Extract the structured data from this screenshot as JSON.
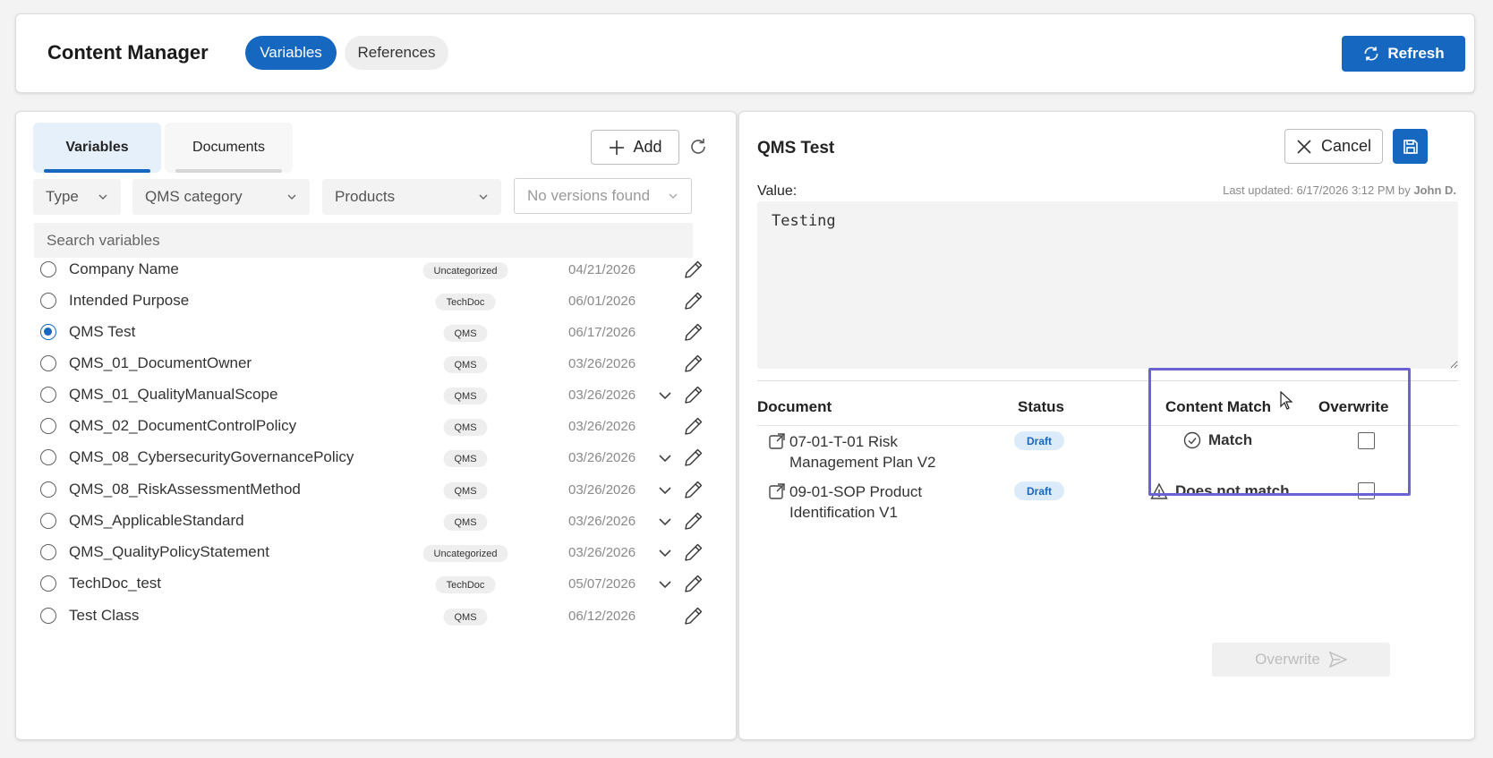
{
  "header": {
    "title": "Content Manager",
    "tabs": [
      {
        "label": "Variables",
        "active": true
      },
      {
        "label": "References",
        "active": false
      }
    ],
    "refresh_label": "Refresh"
  },
  "left": {
    "subtabs": [
      {
        "label": "Variables",
        "active": true
      },
      {
        "label": "Documents",
        "active": false
      }
    ],
    "add_label": "Add",
    "filters": {
      "type": "Type",
      "qms_category": "QMS category",
      "products": "Products",
      "versions": "No versions found"
    },
    "search_placeholder": "Search variables",
    "variables": [
      {
        "name": "Company Name",
        "category": "Uncategorized",
        "date": "04/21/2026",
        "expandable": false,
        "selected": false
      },
      {
        "name": "Intended Purpose",
        "category": "TechDoc",
        "date": "06/01/2026",
        "expandable": false,
        "selected": false
      },
      {
        "name": "QMS Test",
        "category": "QMS",
        "date": "06/17/2026",
        "expandable": false,
        "selected": true
      },
      {
        "name": "QMS_01_DocumentOwner",
        "category": "QMS",
        "date": "03/26/2026",
        "expandable": false,
        "selected": false
      },
      {
        "name": "QMS_01_QualityManualScope",
        "category": "QMS",
        "date": "03/26/2026",
        "expandable": true,
        "selected": false
      },
      {
        "name": "QMS_02_DocumentControlPolicy",
        "category": "QMS",
        "date": "03/26/2026",
        "expandable": false,
        "selected": false
      },
      {
        "name": "QMS_08_CybersecurityGovernancePolicy",
        "category": "QMS",
        "date": "03/26/2026",
        "expandable": true,
        "selected": false
      },
      {
        "name": "QMS_08_RiskAssessmentMethod",
        "category": "QMS",
        "date": "03/26/2026",
        "expandable": true,
        "selected": false
      },
      {
        "name": "QMS_ApplicableStandard",
        "category": "QMS",
        "date": "03/26/2026",
        "expandable": true,
        "selected": false
      },
      {
        "name": "QMS_QualityPolicyStatement",
        "category": "Uncategorized",
        "date": "03/26/2026",
        "expandable": true,
        "selected": false
      },
      {
        "name": "TechDoc_test",
        "category": "TechDoc",
        "date": "05/07/2026",
        "expandable": true,
        "selected": false
      },
      {
        "name": "Test Class",
        "category": "QMS",
        "date": "06/12/2026",
        "expandable": false,
        "selected": false
      }
    ]
  },
  "right": {
    "title": "QMS Test",
    "cancel_label": "Cancel",
    "value_label": "Value:",
    "last_updated_prefix": "Last updated: 6/17/2026 3:12 PM by",
    "last_updated_user": "John D.",
    "value": "Testing",
    "columns": {
      "document": "Document",
      "status": "Status",
      "content_match": "Content Match",
      "overwrite": "Overwrite"
    },
    "documents": [
      {
        "name": "07-01-T-01 Risk Management Plan V2",
        "status": "Draft",
        "match": "Match",
        "match_icon": "check-circle-icon",
        "overwrite": false
      },
      {
        "name": "09-01-SOP Product Identification V1",
        "status": "Draft",
        "match": "Does not match",
        "match_icon": "warning-icon",
        "overwrite": false
      }
    ],
    "overwrite_button": "Overwrite"
  },
  "colors": {
    "accent": "#1567c0",
    "highlight": "#6b62d6",
    "badge_bg": "#dcebfa"
  }
}
